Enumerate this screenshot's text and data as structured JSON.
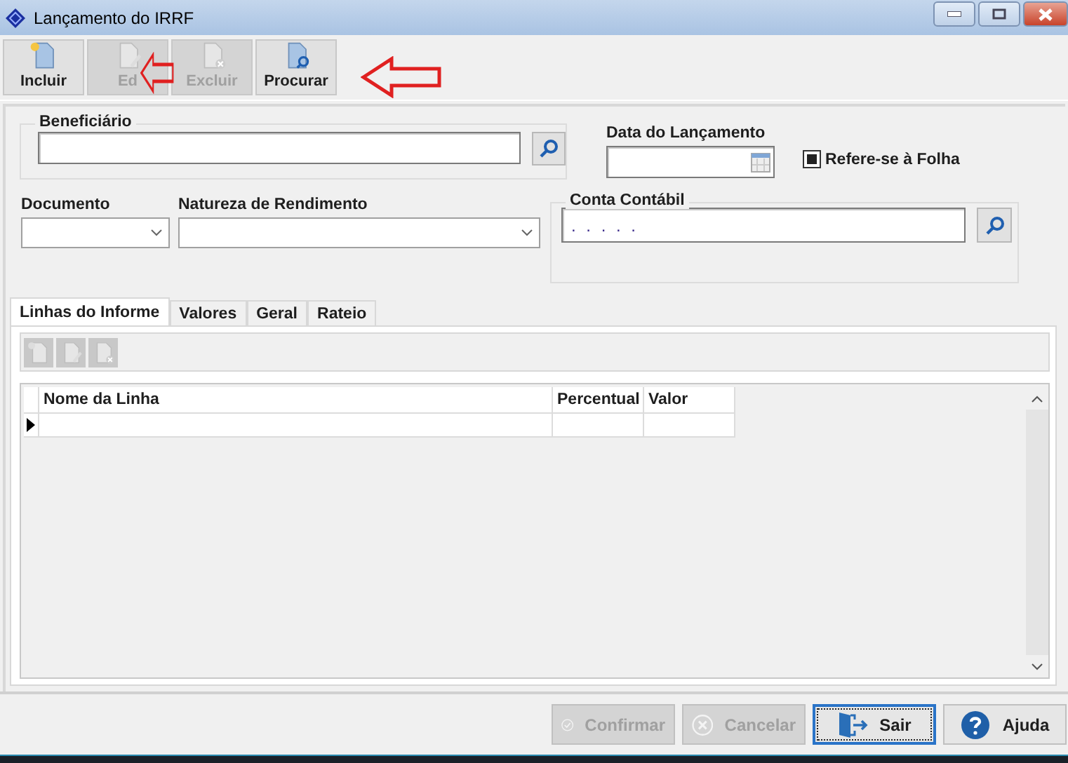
{
  "window": {
    "title": "Lançamento do IRRF"
  },
  "toolbar": [
    {
      "label": "Incluir",
      "kind": "new",
      "disabled": false
    },
    {
      "label": "Ed",
      "kind": "edit",
      "disabled": true
    },
    {
      "label": "Excluir",
      "kind": "delete",
      "disabled": true
    },
    {
      "label": "Procurar",
      "kind": "search",
      "disabled": false
    }
  ],
  "beneficiario": {
    "label": "Beneficiário"
  },
  "data_lancamento": {
    "label": "Data do Lançamento"
  },
  "refere_folha": {
    "label": "Refere-se à Folha",
    "checked": true
  },
  "documento": {
    "label": "Documento"
  },
  "natureza": {
    "label": "Natureza de Rendimento"
  },
  "conta_contabil": {
    "label": "Conta Contábil",
    "value": ". . . . ."
  },
  "tabs": [
    {
      "label": "Linhas do Informe",
      "selected": true
    },
    {
      "label": "Valores",
      "selected": false
    },
    {
      "label": "Geral",
      "selected": false
    },
    {
      "label": "Rateio",
      "selected": false
    }
  ],
  "sub_toolbar": [
    {
      "kind": "new",
      "disabled": true
    },
    {
      "kind": "edit",
      "disabled": true
    },
    {
      "kind": "delete",
      "disabled": true
    }
  ],
  "table": {
    "columns": [
      "Nome da Linha",
      "Percentual",
      "Valor"
    ],
    "rows": [
      {
        "current": true
      }
    ]
  },
  "buttons": [
    {
      "label": "Confirmar",
      "kind": "confirm",
      "disabled": true,
      "focused": false
    },
    {
      "label": "Cancelar",
      "kind": "cancel",
      "disabled": true,
      "focused": false
    },
    {
      "label": "Sair",
      "kind": "exit",
      "disabled": false,
      "focused": true
    },
    {
      "label": "Ajuda",
      "kind": "help",
      "disabled": false,
      "focused": false
    }
  ]
}
